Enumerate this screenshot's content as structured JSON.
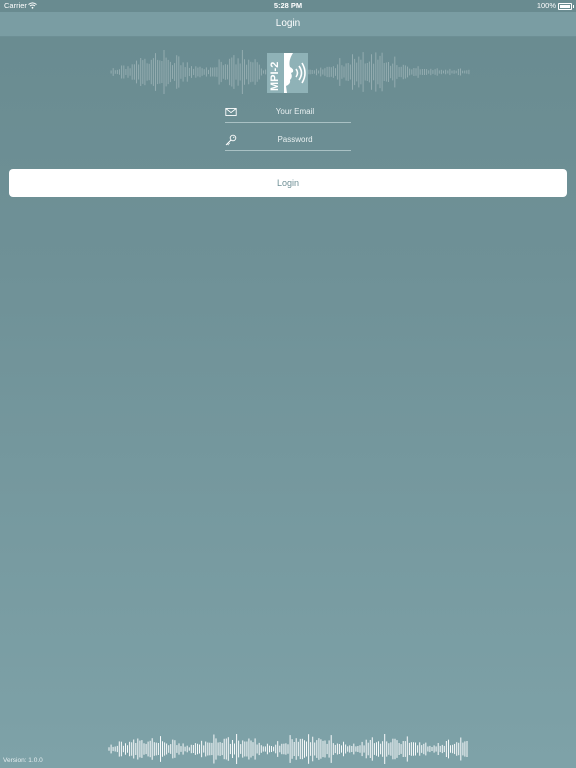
{
  "status_bar": {
    "carrier": "Carrier",
    "time": "5:28 PM",
    "battery": "100%"
  },
  "nav": {
    "title": "Login"
  },
  "logo": {
    "text": "MPI-2"
  },
  "form": {
    "email_placeholder": "Your Email",
    "password_placeholder": "Password",
    "login_label": "Login"
  },
  "footer": {
    "version": "Version: 1.0.0"
  },
  "colors": {
    "nav_background": "#7a9da3",
    "page_top": "#698b90",
    "page_bottom": "#7ea2a8",
    "button_text": "#6e8f95"
  }
}
